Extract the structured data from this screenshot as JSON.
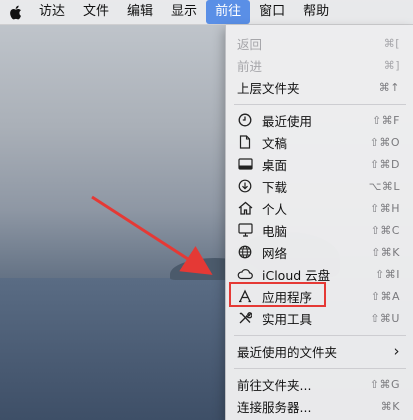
{
  "menubar": {
    "items": [
      {
        "label": "访达"
      },
      {
        "label": "文件"
      },
      {
        "label": "编辑"
      },
      {
        "label": "显示"
      },
      {
        "label": "前往",
        "active": true
      },
      {
        "label": "窗口"
      },
      {
        "label": "帮助"
      }
    ]
  },
  "menu": {
    "items": [
      {
        "label": "返回",
        "shortcut": "⌘[",
        "disabled": true
      },
      {
        "label": "前进",
        "shortcut": "⌘]",
        "disabled": true
      },
      {
        "label": "上层文件夹",
        "shortcut": "⌘↑"
      },
      {
        "label": "最近使用",
        "shortcut": "⇧⌘F",
        "icon": "clock-icon"
      },
      {
        "label": "文稿",
        "shortcut": "⇧⌘O",
        "icon": "document-icon"
      },
      {
        "label": "桌面",
        "shortcut": "⇧⌘D",
        "icon": "desktop-icon"
      },
      {
        "label": "下载",
        "shortcut": "⌥⌘L",
        "icon": "download-icon"
      },
      {
        "label": "个人",
        "shortcut": "⇧⌘H",
        "icon": "home-icon"
      },
      {
        "label": "电脑",
        "shortcut": "⇧⌘C",
        "icon": "computer-icon"
      },
      {
        "label": "网络",
        "shortcut": "⇧⌘K",
        "icon": "network-icon"
      },
      {
        "label": "iCloud 云盘",
        "shortcut": "⇧⌘I",
        "icon": "cloud-icon"
      },
      {
        "label": "应用程序",
        "shortcut": "⇧⌘A",
        "icon": "applications-icon"
      },
      {
        "label": "实用工具",
        "shortcut": "⇧⌘U",
        "icon": "utilities-icon"
      },
      {
        "label": "最近使用的文件夹",
        "shortcut": "›"
      },
      {
        "label": "前往文件夹...",
        "shortcut": "⇧⌘G"
      },
      {
        "label": "连接服务器...",
        "shortcut": "⌘K"
      }
    ]
  },
  "colors": {
    "highlight": "#e53935",
    "menubar_active": "#5a8fe6"
  }
}
